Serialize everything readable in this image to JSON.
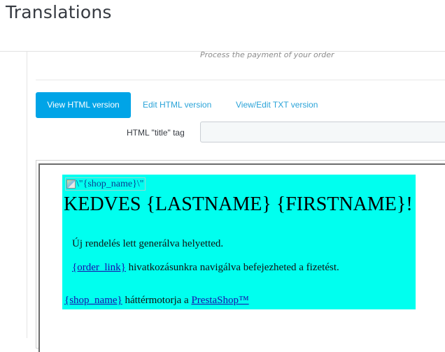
{
  "page": {
    "title": "Translations"
  },
  "email": {
    "subtitle": "Process the payment of your order"
  },
  "tabs": [
    {
      "label": "View HTML version",
      "active": true
    },
    {
      "label": "Edit HTML version",
      "active": false
    },
    {
      "label": "View/Edit TXT version",
      "active": false
    }
  ],
  "title_tag": {
    "label": "HTML \"title\" tag",
    "value": ""
  },
  "preview": {
    "image_alt": "\\\"{shop_name}\\\"",
    "greeting": "KEDVES {LASTNAME} {FIRSTNAME}!",
    "line1": "Új rendelés lett generálva helyetted.",
    "line2_link": "{order_link}",
    "line2_text": " hivatkozásunkra navigálva befejezheted a fizetést.",
    "line3_link": "{shop_name}",
    "line3_text": " háttérmotorja a ",
    "line3_link2": "PrestaShop™",
    "background_color": "#00ffef"
  },
  "colors": {
    "accent": "#00a4e7",
    "link": "#2aa3d8",
    "preview_link": "#1a0dab"
  },
  "icons": {
    "broken_image": "image-placeholder-icon"
  }
}
